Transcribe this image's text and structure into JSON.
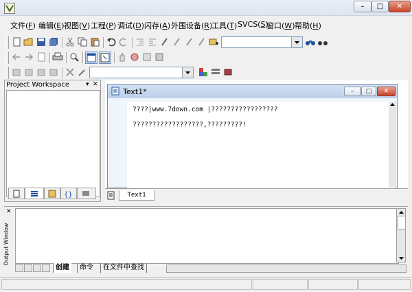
{
  "window": {
    "controls": {
      "minimize": "–",
      "maximize": "□",
      "close": "✕"
    }
  },
  "menu": [
    {
      "label": "文件",
      "key": "F"
    },
    {
      "label": "编辑",
      "key": "E"
    },
    {
      "label": "视图",
      "key": "V"
    },
    {
      "label": "工程",
      "key": "P"
    },
    {
      "label": "调试",
      "key": "D"
    },
    {
      "label": "闪存",
      "key": "A"
    },
    {
      "label": "外围设备",
      "key": "R"
    },
    {
      "label": "工具",
      "key": "T"
    },
    {
      "label": "SVCS",
      "key": "S"
    },
    {
      "label": "窗口",
      "key": "W"
    },
    {
      "label": "帮助",
      "key": "H"
    }
  ],
  "toolbar": {
    "find_combo_value": "",
    "target_combo_value": ""
  },
  "workspace": {
    "title": "Project Workspace",
    "pin": "▾",
    "close": "✕"
  },
  "document": {
    "title": "Text1*",
    "tab_label": "Text1",
    "lines": [
      "????|www.7down.com |?????????????????",
      "??????????????????,?????????!"
    ]
  },
  "output": {
    "title": "Output Window",
    "close": "✕",
    "tabs": [
      "创建",
      "命令",
      "在文件中查找"
    ]
  },
  "colors": {
    "accent": "#6d8fbd",
    "close_button": "#c7432a",
    "editor_bg": "#ffffff"
  }
}
